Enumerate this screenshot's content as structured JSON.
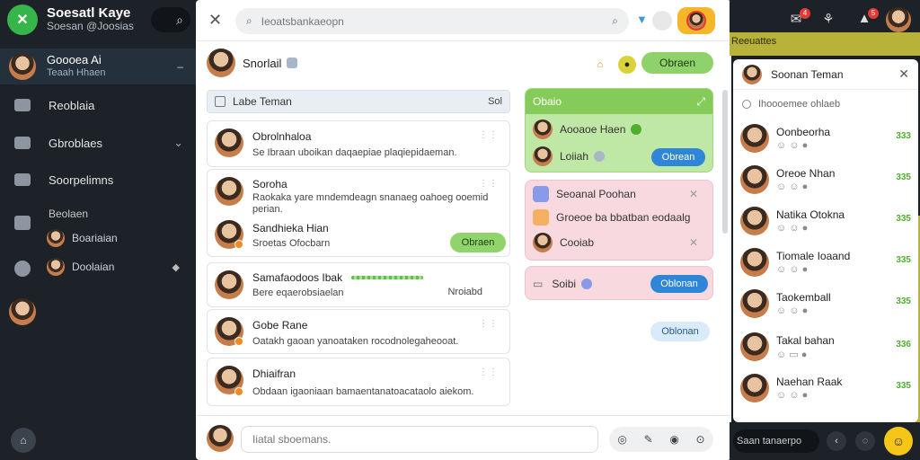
{
  "app": {
    "title": "Soesatl Kaye",
    "subtitle": "Soesan @Joosias"
  },
  "profile": {
    "name": "Goooea Ai",
    "sub": "Teaah Hhaen"
  },
  "nav": [
    {
      "label": "Reoblaia",
      "icon": "people-icon"
    },
    {
      "label": "Gbroblaes",
      "icon": "chart-icon"
    },
    {
      "label": "Soorpelimns",
      "icon": "document-icon"
    }
  ],
  "sub_nav": {
    "heading": "Beolaen",
    "items": [
      {
        "label": "Boariaian"
      },
      {
        "label": "Doolaian"
      }
    ]
  },
  "olive_banner": "Reeuattes",
  "search": {
    "placeholder": "Ieoatsbankaeopn"
  },
  "chat_header": {
    "name": "Snorlail",
    "button": "Obraen"
  },
  "list_header": {
    "title": "Labe Teman",
    "right": "Sol"
  },
  "cards": [
    {
      "name": "Obrolnhaloa",
      "text": "Se  Ibraan uboikan daqaepiae plaqiepidaeman."
    },
    {
      "name": "Soroha",
      "text": "Raokaka yare mndemdeagn snanaeg oahoeg ooemid perian."
    },
    {
      "name": "Sandhieka Hian",
      "text": "Sroetas Ofocbarn",
      "button": "Obraen"
    },
    {
      "name": "Samafaodoos Ibak",
      "text": "Bere eqaerobsiaelan",
      "right": "Nroiabd"
    },
    {
      "name": "Gobe Rane",
      "text": "Oatakh gaoan yanoataken rocodnolegaheooat."
    },
    {
      "name": "Dhiaifran",
      "text": "Obdaan igaoniaan bamaentanatoacataolo aiekom."
    }
  ],
  "green_panel": {
    "title": "Obaio",
    "rows": [
      {
        "label": "Aooaoe Haen"
      },
      {
        "label": "Loiiah"
      }
    ],
    "button": "Obrean"
  },
  "pink_panel": {
    "rows": [
      {
        "label": "Seoanal Poohan"
      },
      {
        "label": "Groeoe ba bbatban eodaalg"
      },
      {
        "label": "Cooiab"
      }
    ]
  },
  "pink_panel2": {
    "label": "Soibi",
    "button": "Oblonan"
  },
  "pill_light": "Oblonan",
  "composer": {
    "placeholder": "Iiatal sboemans."
  },
  "contacts": {
    "title": "Soonan Teman",
    "search_placeholder": "Ihoooemee ohlaeb",
    "items": [
      {
        "name": "Oonbeorha",
        "num": "333"
      },
      {
        "name": "Oreoe Nhan",
        "num": "335"
      },
      {
        "name": "Natika Otokna",
        "num": "335"
      },
      {
        "name": "Tiomale Ioaand",
        "num": "335"
      },
      {
        "name": "Taokemball",
        "num": "335"
      },
      {
        "name": "Takal bahan",
        "num": "336"
      },
      {
        "name": "Naehan Raak",
        "num": "335"
      }
    ]
  },
  "bottom_right": {
    "input": "Saan tanaerpo"
  },
  "badges": {
    "a": "4",
    "b": "5"
  },
  "colors": {
    "accent_green": "#8fd16a",
    "brand_green": "#36b54a",
    "blue": "#2f86d6",
    "orange": "#f5b62a"
  }
}
